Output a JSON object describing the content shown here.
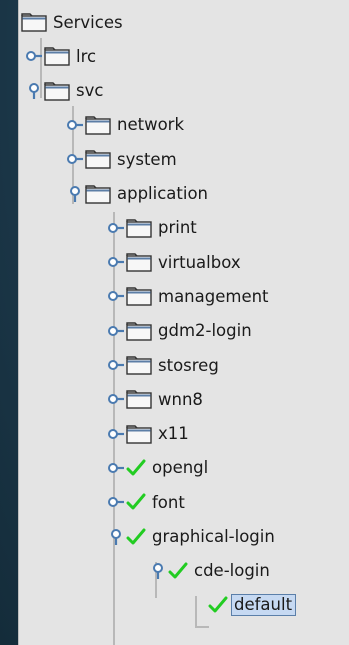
{
  "window": {
    "title": "Services"
  },
  "tree": {
    "root": "Services",
    "nodes": [
      {
        "label": "lrc",
        "icon": "folder-icon",
        "state": "collapsed"
      },
      {
        "label": "svc",
        "icon": "folder-icon",
        "state": "expanded"
      },
      {
        "label": "network",
        "icon": "folder-icon",
        "state": "collapsed"
      },
      {
        "label": "system",
        "icon": "folder-icon",
        "state": "collapsed"
      },
      {
        "label": "application",
        "icon": "folder-icon",
        "state": "expanded"
      },
      {
        "label": "print",
        "icon": "folder-icon",
        "state": "collapsed"
      },
      {
        "label": "virtualbox",
        "icon": "folder-icon",
        "state": "collapsed"
      },
      {
        "label": "management",
        "icon": "folder-icon",
        "state": "collapsed"
      },
      {
        "label": "gdm2-login",
        "icon": "folder-icon",
        "state": "collapsed"
      },
      {
        "label": "stosreg",
        "icon": "folder-icon",
        "state": "collapsed"
      },
      {
        "label": "wnn8",
        "icon": "folder-icon",
        "state": "collapsed"
      },
      {
        "label": "x11",
        "icon": "folder-icon",
        "state": "collapsed"
      },
      {
        "label": "opengl",
        "icon": "check-icon",
        "state": "collapsed"
      },
      {
        "label": "font",
        "icon": "check-icon",
        "state": "collapsed"
      },
      {
        "label": "graphical-login",
        "icon": "check-icon",
        "state": "expanded"
      },
      {
        "label": "cde-login",
        "icon": "check-icon",
        "state": "expanded"
      },
      {
        "label": "default",
        "icon": "check-icon",
        "state": "leaf",
        "selected": true
      }
    ]
  },
  "colors": {
    "check": "#22cc22",
    "selection": "#c6d9f2",
    "handle": "#4a7ab0",
    "guide": "#b8b8b8"
  }
}
